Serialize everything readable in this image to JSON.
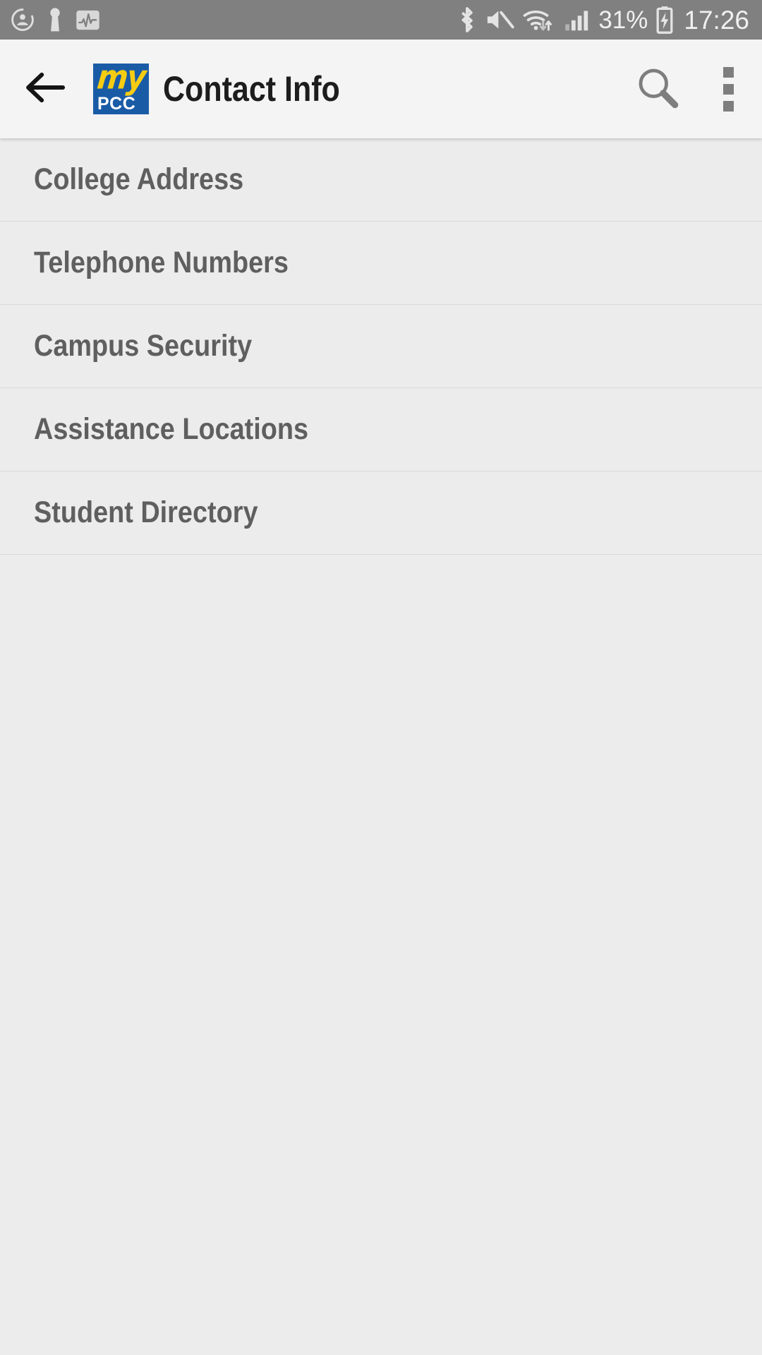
{
  "status_bar": {
    "background_color": "#808080",
    "left_icons": [
      {
        "name": "account-circle-icon"
      },
      {
        "name": "keyhole-icon"
      },
      {
        "name": "activity-monitor-icon"
      }
    ],
    "right_icons": [
      {
        "name": "bluetooth-icon"
      },
      {
        "name": "volume-mute-icon"
      },
      {
        "name": "wifi-data-transfer-icon"
      },
      {
        "name": "cellular-signal-icon"
      }
    ],
    "battery_percent": "31%",
    "battery_icon": "battery-charging-icon",
    "time": "17:26"
  },
  "app_bar": {
    "background_color": "#f4f4f4",
    "back_icon": "back-arrow-icon",
    "logo": {
      "name": "mypcc-logo",
      "top_text": "my",
      "bottom_text": "PCC",
      "box_color": "#1a5ba6",
      "top_text_color": "#f7cc12",
      "bottom_text_color": "#ffffff"
    },
    "title": "Contact Info",
    "title_color": "#1d1d1d",
    "search_icon": "search-icon",
    "overflow_icon": "overflow-menu-icon"
  },
  "list": {
    "background_color": "#ececec",
    "divider_color": "#d9d9d9",
    "label_color": "#5f5f5f",
    "items": [
      {
        "label": "College Address"
      },
      {
        "label": "Telephone Numbers"
      },
      {
        "label": "Campus Security"
      },
      {
        "label": "Assistance Locations"
      },
      {
        "label": "Student Directory"
      }
    ]
  }
}
